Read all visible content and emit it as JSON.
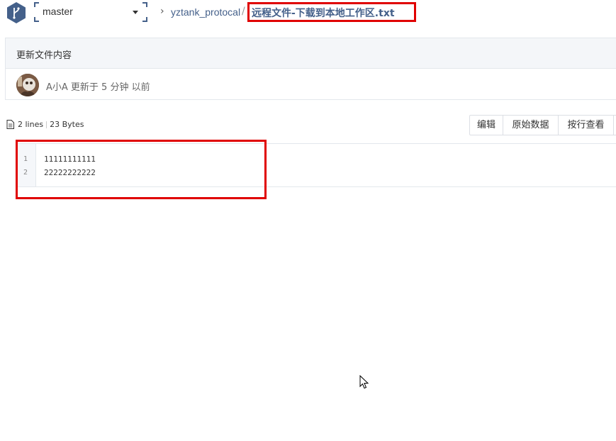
{
  "header": {
    "branch": "master",
    "repo": "yztank_protocal",
    "separator": "/",
    "file_name": "远程文件-下载到本地工作区.txt"
  },
  "commit": {
    "message": "更新文件内容",
    "info": "A小A 更新于 5 分钟 以前"
  },
  "file_meta": {
    "lines": "2 lines",
    "size": "23 Bytes"
  },
  "toolbar": {
    "edit_label": "编辑",
    "raw_label": "原始数据",
    "blame_label": "按行查看"
  },
  "code": {
    "lines": [
      {
        "no": "1",
        "text": "11111111111"
      },
      {
        "no": "2",
        "text": "22222222222"
      }
    ]
  },
  "colors": {
    "accent": "#44608a",
    "highlight": "#e00000"
  }
}
